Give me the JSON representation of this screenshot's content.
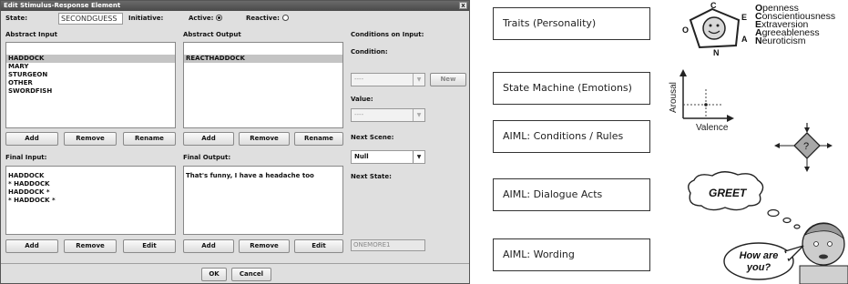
{
  "window": {
    "title": "Edit Stimulus-Response Element",
    "close_glyph": "x",
    "state_label": "State:",
    "state_value": "SECONDGUESS",
    "initiative_label": "Initiative:",
    "active_label": "Active:",
    "active_selected": true,
    "reactive_label": "Reactive:",
    "reactive_selected": false
  },
  "abstract_input": {
    "label": "Abstract Input",
    "items": [
      "HADDOCK",
      "MARY",
      "STURGEON",
      "OTHER",
      "SWORDFISH"
    ],
    "selected_index": 0,
    "buttons": [
      "Add",
      "Remove",
      "Rename"
    ]
  },
  "abstract_output": {
    "label": "Abstract Output",
    "items": [
      "REACTHADDOCK"
    ],
    "selected_index": 0,
    "buttons": [
      "Add",
      "Remove",
      "Rename"
    ]
  },
  "conditions": {
    "header": "Conditions on Input:",
    "condition_label": "Condition:",
    "condition_value": "----",
    "new_button": "New",
    "value_label": "Value:",
    "value_value": "----",
    "next_scene_label": "Next Scene:",
    "next_scene_value": "Null",
    "next_state_label": "Next State:",
    "next_state_value": "ONEMORE1"
  },
  "final_input": {
    "label": "Final Input:",
    "items": [
      "HADDOCK",
      "* HADDOCK",
      "HADDOCK *",
      "* HADDOCK *"
    ],
    "buttons": [
      "Add",
      "Remove",
      "Edit"
    ]
  },
  "final_output": {
    "label": "Final Output:",
    "items": [
      "That's funny, I have a headache too"
    ],
    "buttons": [
      "Add",
      "Remove",
      "Edit"
    ]
  },
  "footer": {
    "ok": "OK",
    "cancel": "Cancel"
  },
  "diagram": {
    "layers": [
      "Traits (Personality)",
      "State Machine (Emotions)",
      "AIML: Conditions / Rules",
      "AIML: Dialogue Acts",
      "AIML: Wording"
    ],
    "ocean_letters": [
      "O",
      "C",
      "E",
      "A",
      "N"
    ],
    "ocean": [
      {
        "initial": "O",
        "rest": "penness"
      },
      {
        "initial": "C",
        "rest": "onscientiousness"
      },
      {
        "initial": "E",
        "rest": "xtraversion"
      },
      {
        "initial": "A",
        "rest": "greeableness"
      },
      {
        "initial": "N",
        "rest": "euroticism"
      }
    ],
    "arousal_label": "Arousal",
    "valence_label": "Valence",
    "decision_label": "?",
    "thought_text": "GREET",
    "speech_text": "How are you?"
  },
  "colors": {
    "dialog_bg": "#dfdfdf",
    "selection": "#c4c4c4",
    "diamond_fill": "#a8a8a8",
    "face_fill": "#cccccc"
  }
}
